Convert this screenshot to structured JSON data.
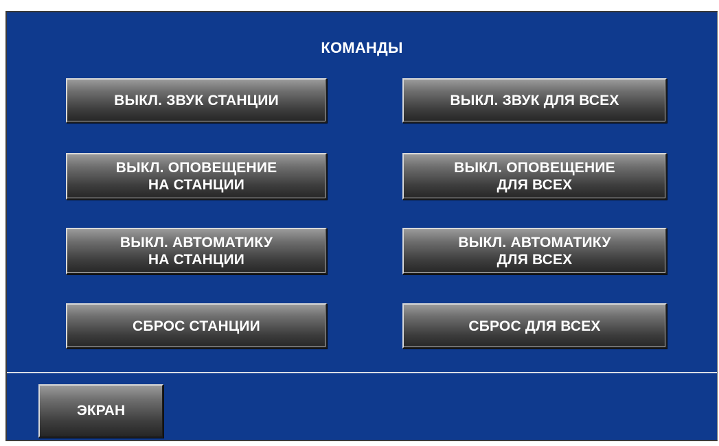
{
  "panel": {
    "title": "КОМАНДЫ"
  },
  "commands": {
    "mute_station": "ВЫКЛ. ЗВУК СТАНЦИИ",
    "mute_all": "ВЫКЛ. ЗВУК ДЛЯ ВСЕХ",
    "alert_off_station": "ВЫКЛ. ОПОВЕЩЕНИЕ\nНА СТАНЦИИ",
    "alert_off_all": "ВЫКЛ. ОПОВЕЩЕНИЕ\nДЛЯ ВСЕХ",
    "auto_off_station": "ВЫКЛ. АВТОМАТИКУ\nНА СТАНЦИИ",
    "auto_off_all": "ВЫКЛ. АВТОМАТИКУ\nДЛЯ ВСЕХ",
    "reset_station": "СБРОС СТАНЦИИ",
    "reset_all": "СБРОС ДЛЯ ВСЕХ"
  },
  "footer": {
    "screen_button": "ЭКРАН"
  },
  "colors": {
    "panel_background": "#0f3a8e",
    "button_gradient_top": "#9a9a9a",
    "button_gradient_bottom": "#262626",
    "text": "#ffffff",
    "divider": "#d9dde6"
  }
}
